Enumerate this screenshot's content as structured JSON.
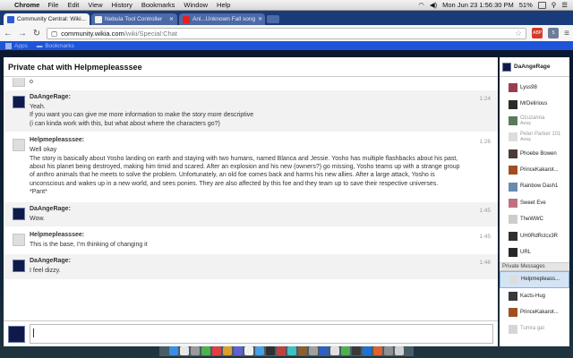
{
  "menubar": {
    "app": "Chrome",
    "menus": [
      "File",
      "Edit",
      "View",
      "History",
      "Bookmarks",
      "Window",
      "Help"
    ],
    "clock": "Mon Jun 23  1:56:30 PM",
    "battery": "51%"
  },
  "tabs": [
    {
      "title": "Community Central: Wiki...",
      "active": true,
      "favicon_color": "#2d5bd6"
    },
    {
      "title": "Nebula Tool Controller",
      "active": false,
      "favicon_color": "#f0f0f0"
    },
    {
      "title": "Ani...Unknown Fall song",
      "active": false,
      "favicon_color": "#e62117"
    }
  ],
  "address": {
    "host": "community.wikia.com",
    "path": "/wiki/Special:Chat"
  },
  "bookmarks": {
    "apps": "Apps",
    "folder": "Bookmarks"
  },
  "chat": {
    "title": "Private chat with Helpmepleasssee",
    "messages": [
      {
        "user": "",
        "time": "",
        "avatar": "ghost",
        "lines": [
          "o"
        ],
        "shade": false
      },
      {
        "user": "DaAngeRage:",
        "time": "1:24",
        "avatar": "navy",
        "shade": true,
        "lines": [
          "Yeah.",
          "If you want you can give me more information to make the story more descriptive",
          "(i can kinda work with this, but what about where the characters go?)"
        ]
      },
      {
        "user": "Helpmepleasssee:",
        "time": "1:26",
        "avatar": "ghost",
        "shade": false,
        "lines": [
          "Well okay",
          "The story is basically about Yosho landing on earth and staying with two humans, named Blanca and Jessie. Yosho has multiple flashbacks about his past, about his planet being destroyed, making him timid and scared. After an explosion and his new (owners?) go missing, Yosho teams up with a strange group of anthro animals that he meets to solve the problem. Unfortunately, an old foe comes back and harms his new allies. After a large attack, Yosho is unconscious and wakes up in a new world, and sees ponies. They are also affected by this foe and they team up to save their respective universes.",
          "*Pant*"
        ]
      },
      {
        "user": "DaAngeRage:",
        "time": "1:45",
        "avatar": "navy",
        "shade": true,
        "lines": [
          "Wow."
        ]
      },
      {
        "user": "Helpmepleasssee:",
        "time": "1:45",
        "avatar": "ghost",
        "shade": false,
        "lines": [
          "This is the base, I'm thinking of changing it"
        ]
      },
      {
        "user": "DaAngeRage:",
        "time": "1:46",
        "avatar": "navy",
        "shade": true,
        "lines": [
          "I feel dizzy."
        ]
      }
    ]
  },
  "sidebar": {
    "me": "DaAngeRage",
    "users": [
      {
        "name": "Lyss98",
        "status": "",
        "color": "#9a3d52"
      },
      {
        "name": "MrDelirious",
        "status": "",
        "color": "#2b2b2b"
      },
      {
        "name": "Ozuzanna",
        "status": "Away",
        "color": "#5a7a5a"
      },
      {
        "name": "Peter Parker 101",
        "status": "Away",
        "color": "#dddddd"
      },
      {
        "name": "Phoebe Bowen",
        "status": "",
        "color": "#4a3a3a"
      },
      {
        "name": "PrinceKakarot...",
        "status": "",
        "color": "#a05020"
      },
      {
        "name": "Rainbow Dash1",
        "status": "",
        "color": "#6a8ab0"
      },
      {
        "name": "Sweet Eve",
        "status": "",
        "color": "#c07080"
      },
      {
        "name": "TheWWC",
        "status": "",
        "color": "#cccccc"
      },
      {
        "name": "UH0RdRclcx3R",
        "status": "",
        "color": "#303030"
      },
      {
        "name": "URL",
        "status": "",
        "color": "#282828"
      }
    ],
    "private_header": "Private Messages",
    "private": [
      {
        "name": "Helpmepleass...",
        "selected": true,
        "away": false,
        "color": "#dddddd"
      },
      {
        "name": "Kacts-Hug",
        "selected": false,
        "away": false,
        "color": "#3a3a3a"
      },
      {
        "name": "PrinceKakarot...",
        "selected": false,
        "away": false,
        "color": "#a05020"
      },
      {
        "name": "Tumra gal",
        "selected": false,
        "away": true,
        "color": "#d6d6d6"
      }
    ]
  },
  "dock_colors": [
    "#3a8ee6",
    "#e8e8e8",
    "#9a9a9a",
    "#4fb04f",
    "#e04040",
    "#d8a030",
    "#6060d0",
    "#f0f0f0",
    "#48a0e0",
    "#303030",
    "#c04040",
    "#40c0c0",
    "#8a6030",
    "#a0a0a0",
    "#3060c0",
    "#e0e0e0",
    "#50b050",
    "#3a3a3a",
    "#2070d0",
    "#e06030",
    "#909090",
    "#d0d0d0"
  ]
}
